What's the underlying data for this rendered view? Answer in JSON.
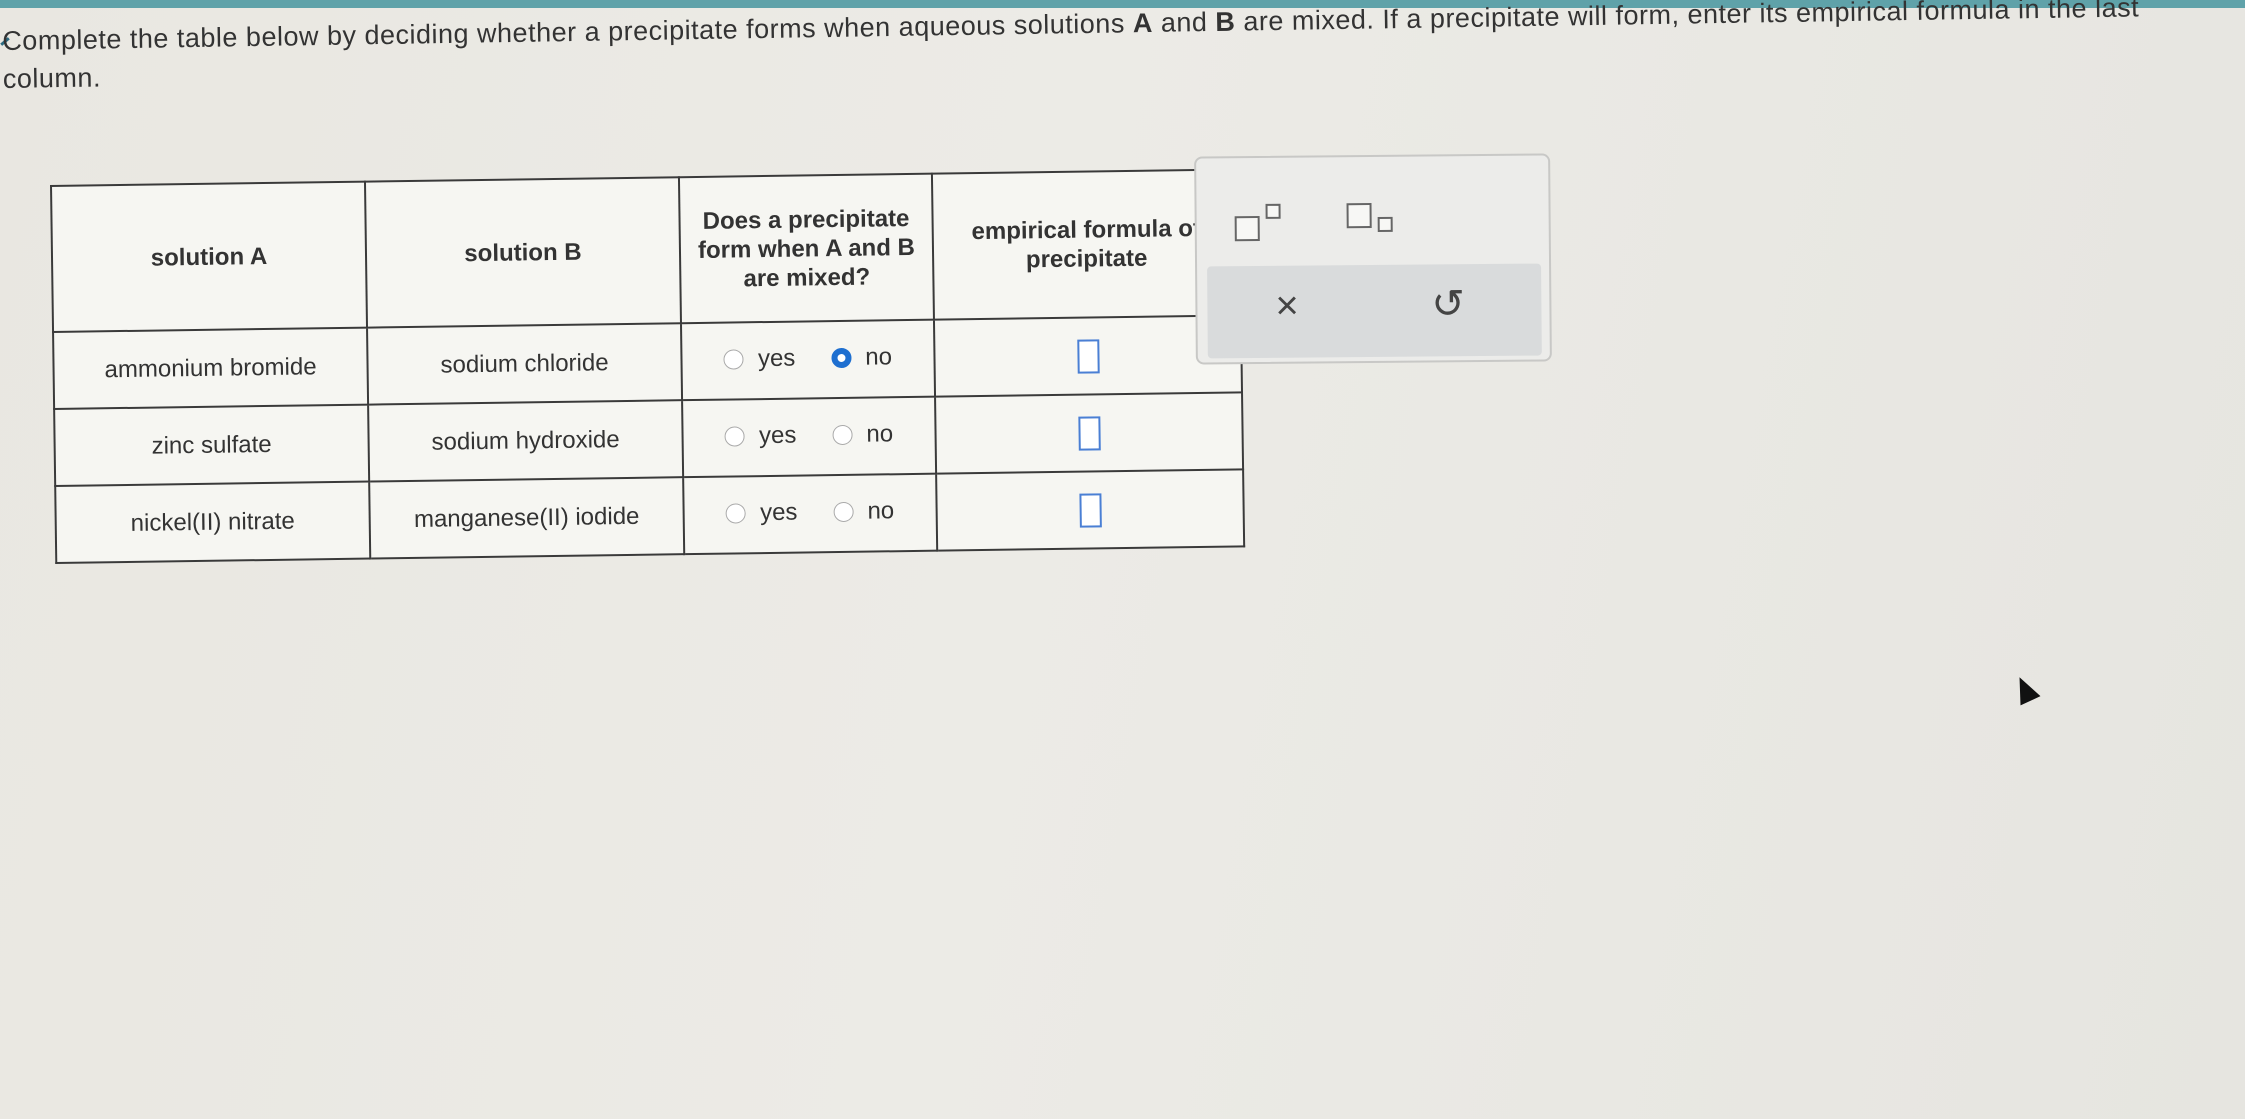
{
  "prompt": {
    "part1": "Complete the table below by deciding whether a precipitate forms when aqueous solutions ",
    "bold_a": "A",
    "part2": " and ",
    "bold_b": "B",
    "part3": " are mixed. If a precipitate will form, enter its empirical formula in the last column."
  },
  "table": {
    "headers": [
      "solution A",
      "solution B",
      "Does a precipitate form when A and B are mixed?",
      "empirical formula of precipitate"
    ],
    "rows": [
      {
        "solution_a": "ammonium bromide",
        "solution_b": "sodium chloride",
        "yes_label": "yes",
        "no_label": "no",
        "selected": "no"
      },
      {
        "solution_a": "zinc sulfate",
        "solution_b": "sodium hydroxide",
        "yes_label": "yes",
        "no_label": "no",
        "selected": ""
      },
      {
        "solution_a": "nickel(II) nitrate",
        "solution_b": "manganese(II) iodide",
        "yes_label": "yes",
        "no_label": "no",
        "selected": ""
      }
    ]
  },
  "tools": {
    "superscript_icon": "superscript-icon",
    "subscript_icon": "subscript-icon",
    "clear_symbol": "×",
    "undo_symbol": "↺"
  },
  "colors": {
    "radio_selected": "#1e6fd0",
    "input_border": "#4a7fd4",
    "top_strip": "#5fa2a9"
  }
}
